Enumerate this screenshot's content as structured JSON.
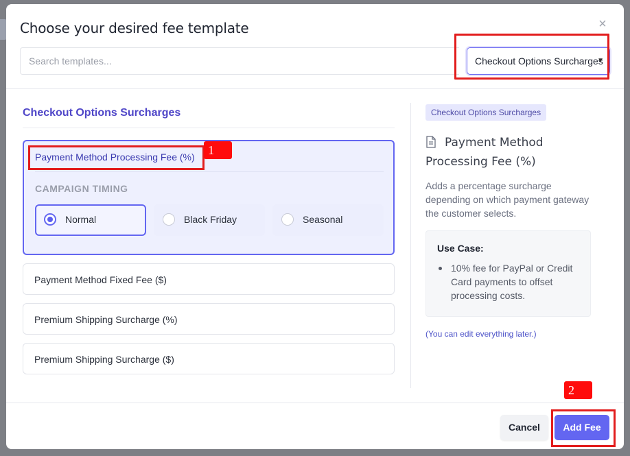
{
  "modal": {
    "title": "Choose your desired fee template",
    "close_glyph": "×"
  },
  "search": {
    "placeholder": "Search templates..."
  },
  "category_select": {
    "selected": "Checkout Options Surcharges",
    "chevron": "▼"
  },
  "section": {
    "title": "Checkout Options Surcharges"
  },
  "templates": [
    {
      "label": "Payment Method Processing Fee (%)",
      "selected": true
    },
    {
      "label": "Payment Method Fixed Fee ($)",
      "selected": false
    },
    {
      "label": "Premium Shipping Surcharge (%)",
      "selected": false
    },
    {
      "label": "Premium Shipping Surcharge ($)",
      "selected": false
    }
  ],
  "campaign_timing": {
    "label": "CAMPAIGN TIMING",
    "options": [
      "Normal",
      "Black Friday",
      "Seasonal"
    ],
    "selected": "Normal"
  },
  "detail": {
    "tag": "Checkout Options Surcharges",
    "icon": "document-icon",
    "name": "Payment Method Processing Fee (%)",
    "description": "Adds a percentage surcharge depending on which payment gateway the customer selects.",
    "use_case_title": "Use Case:",
    "use_case_items": [
      "10% fee for PayPal or Credit Card payments to offset processing costs."
    ],
    "edit_note": "(You can edit everything later.)"
  },
  "footer": {
    "cancel_label": "Cancel",
    "add_label": "Add Fee"
  },
  "annotations": {
    "step1": "1",
    "step2": "2"
  },
  "colors": {
    "accent": "#6366f1",
    "annotation_red": "#e21d1d"
  }
}
